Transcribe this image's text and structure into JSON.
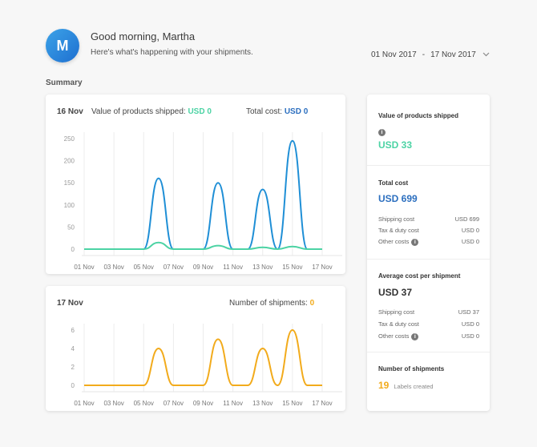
{
  "user": {
    "initial": "M",
    "greeting": "Good morning, Martha",
    "subtext": "Here's what's happening with your shipments."
  },
  "daterange": {
    "start": "01 Nov 2017",
    "sep": "-",
    "end": "17 Nov 2017"
  },
  "summary_label": "Summary",
  "value_chart": {
    "date": "16 Nov",
    "value_label": "Value of products shipped:",
    "value_amount": "USD 0",
    "cost_label": "Total cost:",
    "cost_amount": "USD 0",
    "y_ticks": [
      "250",
      "200",
      "150",
      "100",
      "50",
      "0"
    ],
    "x_ticks": [
      "01 Nov",
      "03 Nov",
      "05 Nov",
      "07 Nov",
      "09 Nov",
      "11 Nov",
      "13 Nov",
      "15 Nov",
      "17 Nov"
    ]
  },
  "shipments_chart": {
    "date": "17 Nov",
    "count_label": "Number of shipments:",
    "count_value": "0",
    "y_ticks": [
      "6",
      "4",
      "2",
      "0"
    ],
    "x_ticks": [
      "01 Nov",
      "03 Nov",
      "05 Nov",
      "07 Nov",
      "09 Nov",
      "11 Nov",
      "13 Nov",
      "15 Nov",
      "17 Nov"
    ]
  },
  "chart_data": [
    {
      "type": "line",
      "x": [
        "01 Nov",
        "02 Nov",
        "03 Nov",
        "04 Nov",
        "05 Nov",
        "06 Nov",
        "07 Nov",
        "08 Nov",
        "09 Nov",
        "10 Nov",
        "11 Nov",
        "12 Nov",
        "13 Nov",
        "14 Nov",
        "15 Nov",
        "16 Nov",
        "17 Nov"
      ],
      "series": [
        {
          "values": [
            0,
            0,
            0,
            0,
            0,
            160,
            0,
            0,
            0,
            150,
            0,
            0,
            135,
            0,
            245,
            0,
            0
          ],
          "color": "#1f8fd6"
        },
        {
          "values": [
            0,
            0,
            0,
            0,
            0,
            15,
            0,
            0,
            0,
            8,
            0,
            0,
            4,
            0,
            6,
            0,
            0
          ],
          "color": "#4cd3a4"
        }
      ],
      "ylim": [
        0,
        250
      ],
      "grid": true
    },
    {
      "type": "line",
      "x": [
        "01 Nov",
        "02 Nov",
        "03 Nov",
        "04 Nov",
        "05 Nov",
        "06 Nov",
        "07 Nov",
        "08 Nov",
        "09 Nov",
        "10 Nov",
        "11 Nov",
        "12 Nov",
        "13 Nov",
        "14 Nov",
        "15 Nov",
        "16 Nov",
        "17 Nov"
      ],
      "series": [
        {
          "values": [
            0,
            0,
            0,
            0,
            0,
            4,
            0,
            0,
            0,
            5,
            0,
            0,
            4,
            0,
            6,
            0,
            0
          ],
          "color": "#f2ab1c"
        }
      ],
      "ylim": [
        0,
        6
      ],
      "grid": true
    }
  ],
  "side": {
    "value_title": "Value of products shipped",
    "value_amount": "USD 33",
    "cost_title": "Total cost",
    "cost_amount": "USD 699",
    "cost_rows": [
      {
        "label": "Shipping cost",
        "value": "USD 699"
      },
      {
        "label": "Tax & duty cost",
        "value": "USD 0"
      },
      {
        "label": "Other costs",
        "value": "USD 0"
      }
    ],
    "avg_title": "Average cost per shipment",
    "avg_amount": "USD 37",
    "avg_rows": [
      {
        "label": "Shipping cost",
        "value": "USD 37"
      },
      {
        "label": "Tax & duty cost",
        "value": "USD 0"
      },
      {
        "label": "Other costs",
        "value": "USD 0"
      }
    ],
    "ship_title": "Number of shipments",
    "ship_count": "19",
    "ship_labels": "Labels created",
    "info_glyph": "i"
  }
}
